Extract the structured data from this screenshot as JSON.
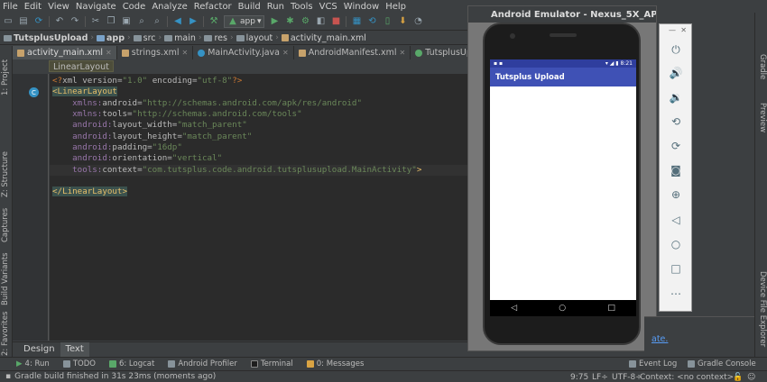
{
  "menu": [
    "File",
    "Edit",
    "View",
    "Navigate",
    "Code",
    "Analyze",
    "Refactor",
    "Build",
    "Run",
    "Tools",
    "VCS",
    "Window",
    "Help"
  ],
  "toolbar": {
    "run_config": "app"
  },
  "breadcrumb": [
    "TutsplusUpload",
    "app",
    "src",
    "main",
    "res",
    "layout",
    "activity_main.xml"
  ],
  "tabs": [
    "activity_main.xml",
    "strings.xml",
    "MainActivity.java",
    "AndroidManifest.xml",
    "TutsplusUpload"
  ],
  "editor": {
    "element_crumb": "LinearLayout",
    "design_tab": "Design",
    "text_tab": "Text"
  },
  "code": {
    "l1_pi_open": "<?",
    "l1_xml": "xml ",
    "l1_version_attr": "version=",
    "l1_version_val": "\"1.0\"",
    "l1_encoding_attr": " encoding=",
    "l1_encoding_val": "\"utf-8\"",
    "l1_pi_close": "?>",
    "l2_tag": "<LinearLayout",
    "l3_ns": "xmlns:",
    "l3_attr": "android=",
    "l3_val": "\"http://schemas.android.com/apk/res/android\"",
    "l4_ns": "xmlns:",
    "l4_attr": "tools=",
    "l4_val": "\"http://schemas.android.com/tools\"",
    "l5_ns": "android:",
    "l5_attr": "layout_width=",
    "l5_val": "\"match_parent\"",
    "l6_ns": "android:",
    "l6_attr": "layout_height=",
    "l6_val": "\"match_parent\"",
    "l7_ns": "android:",
    "l7_attr": "padding=",
    "l7_val": "\"16dp\"",
    "l8_ns": "android:",
    "l8_attr": "orientation=",
    "l8_val": "\"vertical\"",
    "l9_ns": "tools:",
    "l9_attr": "context=",
    "l9_val": "\"com.tutsplus.code.android.tutsplusupload.MainActivity\"",
    "l9_close": ">",
    "l11_tag": "</LinearLayout>"
  },
  "left_tools": [
    "1: Project",
    "Z: Structure",
    "Captures",
    "Build Variants",
    "2: Favorites"
  ],
  "right_tools": [
    "Gradle",
    "Preview",
    "Device File Explorer"
  ],
  "emulator": {
    "title": "Android Emulator - Nexus_5X_API_23:",
    "clock": "8:21",
    "app_title": "Tutsplus Upload"
  },
  "link_fragment": "ate.",
  "bottom_tools": [
    "4: Run",
    "TODO",
    "6: Logcat",
    "Android Profiler",
    "Terminal",
    "0: Messages"
  ],
  "bottom_right_tools": [
    "Event Log",
    "Gradle Console"
  ],
  "status": {
    "message": "Gradle build finished in 31s 23ms (moments ago)",
    "position": "9:75",
    "line_sep": "LF÷",
    "encoding": "UTF-8÷",
    "context": "Context: <no context>"
  }
}
